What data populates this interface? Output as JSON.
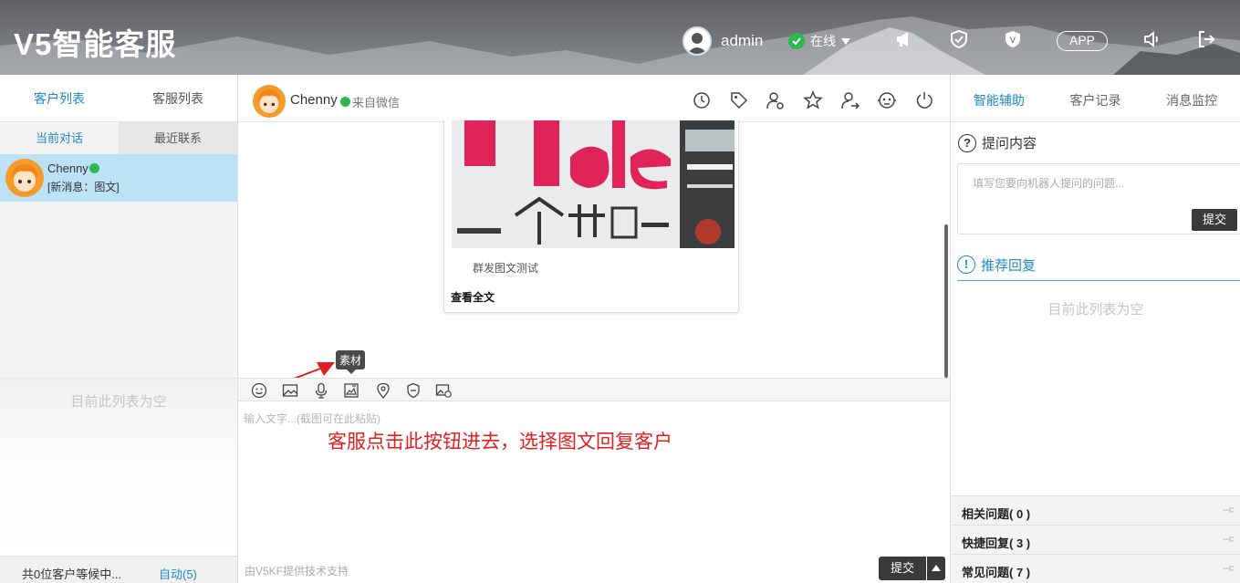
{
  "header": {
    "app_title": "V5智能客服",
    "username": "admin",
    "status": "在线",
    "app_button": "APP"
  },
  "left": {
    "tabs": [
      "客户列表",
      "客服列表"
    ],
    "subtabs": [
      "当前对话",
      "最近联系"
    ],
    "conversation": {
      "name": "Chenny",
      "message": "[新消息：图文]"
    },
    "queue_empty": "目前此列表为空",
    "footer": {
      "waiting": "共0位客户等候中...",
      "auto": "自动(5)"
    }
  },
  "chat": {
    "customer_name": "Chenny",
    "source": "来自微信",
    "card": {
      "title": "群发图文测试",
      "read_more": "查看全文"
    },
    "tooltip": "素材",
    "input_placeholder": "输入文字...(截图可在此粘贴)",
    "annotation": "客服点击此按钮进去，选择图文回复客户",
    "powered_by": "由V5KF提供技术支持",
    "send_label": "提交"
  },
  "right": {
    "tabs": [
      "智能辅助",
      "客户记录",
      "消息监控"
    ],
    "ask_title": "提问内容",
    "ask_placeholder": "填写您要向机器人提问的问题...",
    "ask_submit": "提交",
    "recommend_title": "推荐回复",
    "recommend_empty": "目前此列表为空",
    "accordions": [
      {
        "label": "相关问题( 0 )"
      },
      {
        "label": "快捷回复( 3 )"
      },
      {
        "label": "常见问题( 7 )"
      }
    ]
  },
  "colors": {
    "accent": "#1e88c9",
    "online": "#2db84d",
    "annotation": "#e31e1e",
    "button": "#3a3a3a"
  },
  "icons": [
    "history-icon",
    "tag-icon",
    "user-settings-icon",
    "star-icon",
    "transfer-icon",
    "robot-icon",
    "power-icon"
  ]
}
